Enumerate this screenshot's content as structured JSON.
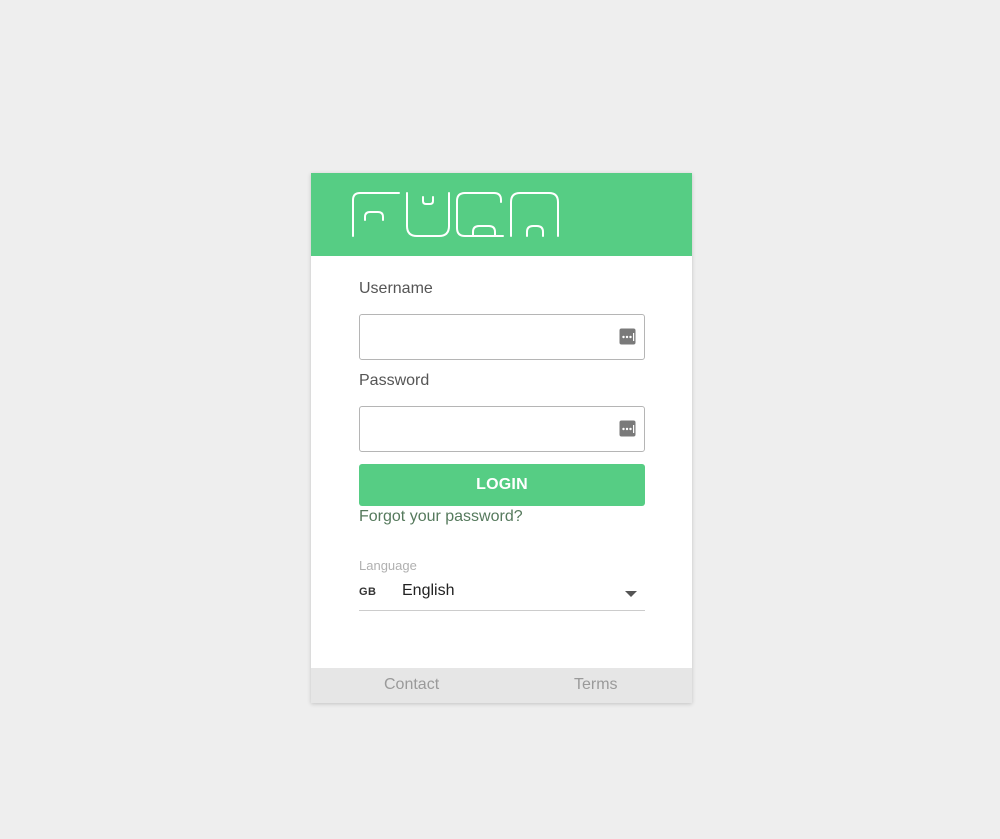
{
  "brand": {
    "logo_text": "FUGA",
    "accent_color": "#56cd84"
  },
  "form": {
    "username_label": "Username",
    "username_value": "",
    "username_icon": "password-manager-icon",
    "password_label": "Password",
    "password_value": "",
    "password_icon": "password-manager-icon",
    "login_label": "LOGIN",
    "forgot_label": "Forgot your password?"
  },
  "language": {
    "label": "Language",
    "code": "GB",
    "selected": "English"
  },
  "footer": {
    "contact_label": "Contact",
    "terms_label": "Terms"
  }
}
